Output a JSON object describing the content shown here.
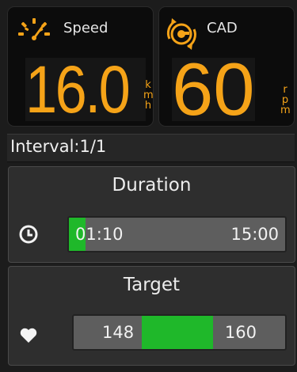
{
  "speed": {
    "label": "Speed",
    "value": "16.0",
    "unit_chars": [
      "k",
      "m",
      "h"
    ],
    "icon": "speedometer-icon"
  },
  "cadence": {
    "label": "CAD",
    "value": "60",
    "unit_chars": [
      "r",
      "p",
      "m"
    ],
    "icon": "cadence-icon"
  },
  "interval": {
    "text": "Interval:1/1"
  },
  "duration": {
    "title": "Duration",
    "icon": "clock-icon",
    "elapsed": "01:10",
    "total": "15:00",
    "progress_fraction": 0.0778
  },
  "target": {
    "title": "Target",
    "icon": "heart-icon",
    "low": "148",
    "high": "160"
  },
  "colors": {
    "accent": "#f5a318",
    "progress": "#1fb82a"
  }
}
